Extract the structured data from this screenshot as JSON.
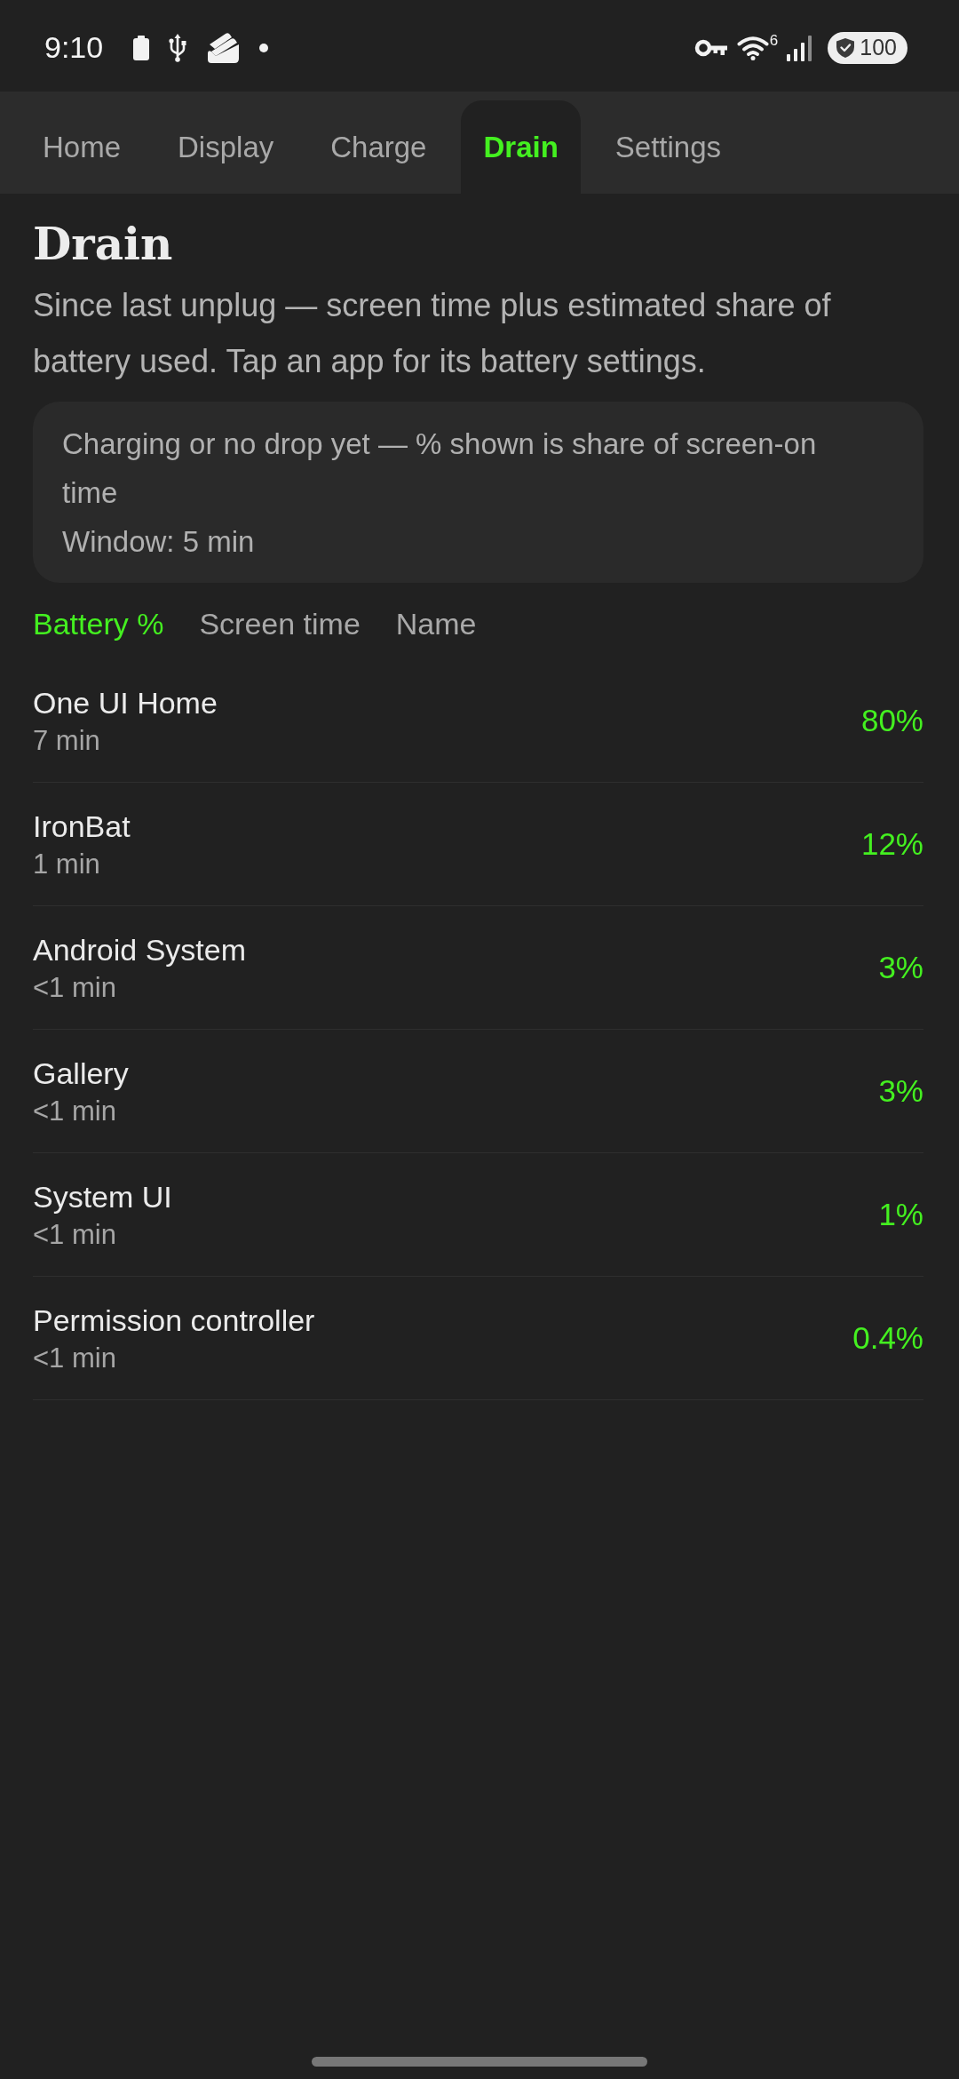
{
  "status_bar": {
    "time": "9:10",
    "wifi_badge": "6",
    "battery": "100"
  },
  "tabs": [
    {
      "label": "Home",
      "selected": false
    },
    {
      "label": "Display",
      "selected": false
    },
    {
      "label": "Charge",
      "selected": false
    },
    {
      "label": "Drain",
      "selected": true
    },
    {
      "label": "Settings",
      "selected": false
    }
  ],
  "page": {
    "title": "Drain",
    "subtitle": "Since last unplug — screen time plus estimated share of battery used. Tap an app for its battery settings.",
    "notice": [
      "Charging or no drop yet — % shown is share of screen-on time",
      "Window: 5 min"
    ]
  },
  "sort_options": [
    {
      "label": "Battery %",
      "selected": true
    },
    {
      "label": "Screen time",
      "selected": false
    },
    {
      "label": "Name",
      "selected": false
    }
  ],
  "apps": [
    {
      "name": "One UI Home",
      "screen_time": "7 min",
      "share": "80%"
    },
    {
      "name": "IronBat",
      "screen_time": "1 min",
      "share": "12%"
    },
    {
      "name": "Android System",
      "screen_time": "<1 min",
      "share": "3%"
    },
    {
      "name": "Gallery",
      "screen_time": "<1 min",
      "share": "3%"
    },
    {
      "name": "System UI",
      "screen_time": "<1 min",
      "share": "1%"
    },
    {
      "name": "Permission controller",
      "screen_time": "<1 min",
      "share": "0.4%"
    }
  ]
}
